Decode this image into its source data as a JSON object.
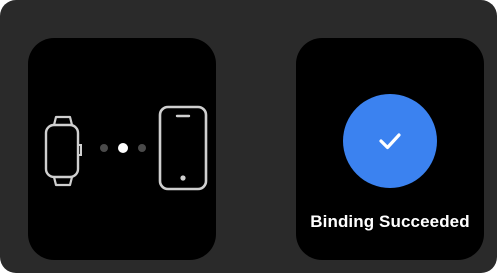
{
  "pairing_screen": {
    "icons": [
      "watch-icon",
      "phone-icon"
    ],
    "indicator_dots": [
      "inactive",
      "active",
      "inactive"
    ]
  },
  "success_screen": {
    "icon": "check-icon",
    "accent_color": "#3b82f0",
    "status_text": "Binding Succeeded"
  }
}
